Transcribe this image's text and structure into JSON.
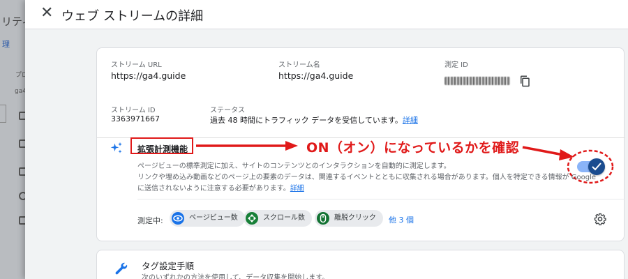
{
  "background": {
    "title_fragment": " リティ",
    "menu_fragment": "理",
    "label_fragment": "プロ",
    "value_fragment": "ga4"
  },
  "panel": {
    "title": "ウェブ ストリームの詳細"
  },
  "stream": {
    "url_label": "ストリーム URL",
    "url_value": "https://ga4.guide",
    "name_label": "ストリーム名",
    "name_value": "https://ga4.guide",
    "measure_id_label": "測定 ID",
    "id_label": "ストリーム ID",
    "id_value": "3363971667",
    "status_label": "ステータス",
    "status_value": "過去 48 時間にトラフィック データを受信しています。",
    "status_link": "詳細"
  },
  "enhanced": {
    "title": "拡張計測機能",
    "desc_line1": "ページビューの標準測定に加え、サイトのコンテンツとのインタラクションを自動的に測定します。",
    "desc_line2": "リンクや埋め込み動画などのページ上の要素のデータは、関連するイベントとともに収集される場合があります。個人を特定できる情報が Google",
    "desc_line3": "に送信されないように注意する必要があります。",
    "desc_link": "詳細",
    "toggle_on": true,
    "measuring_label": "測定中:",
    "chips": [
      "ページビュー数",
      "スクロール数",
      "離脱クリック"
    ],
    "more": "他 3 個"
  },
  "annotation": {
    "text": "ON（オン）になっているかを確認"
  },
  "tag_setup": {
    "title": "タグ設定手順",
    "desc": "次のいずれかの方法を使用して、データ収集を開始します。"
  },
  "colors": {
    "annotation_red": "#e01919",
    "link_blue": "#1a73e8",
    "toggle_track": "#8ab4f8",
    "toggle_knob": "#1a4c8f"
  }
}
